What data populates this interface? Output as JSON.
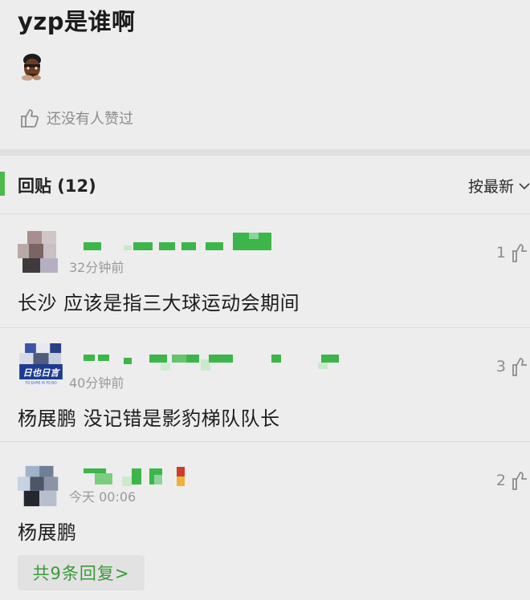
{
  "post": {
    "title": "yzp是谁啊",
    "likes_text": "还没有人赞过"
  },
  "replies": {
    "title": "回贴 (12)",
    "sort_label": "按最新"
  },
  "comments": [
    {
      "time": "32分钟前",
      "text": "长沙 应该是指三大球运动会期间",
      "likes": "1"
    },
    {
      "time": "40分钟前",
      "text": "杨展鹏 没记错是影豹梯队队长",
      "likes": "3",
      "avatar_badge": "TO DARE IS TO DO"
    },
    {
      "time": "今天 00:06",
      "text": "杨展鹏",
      "likes": "2",
      "reply_button": "共9条回复>"
    }
  ],
  "colors": {
    "accent_green": "#4cbb4a",
    "reply_green": "#3a9a3a",
    "background": "#ededed"
  }
}
